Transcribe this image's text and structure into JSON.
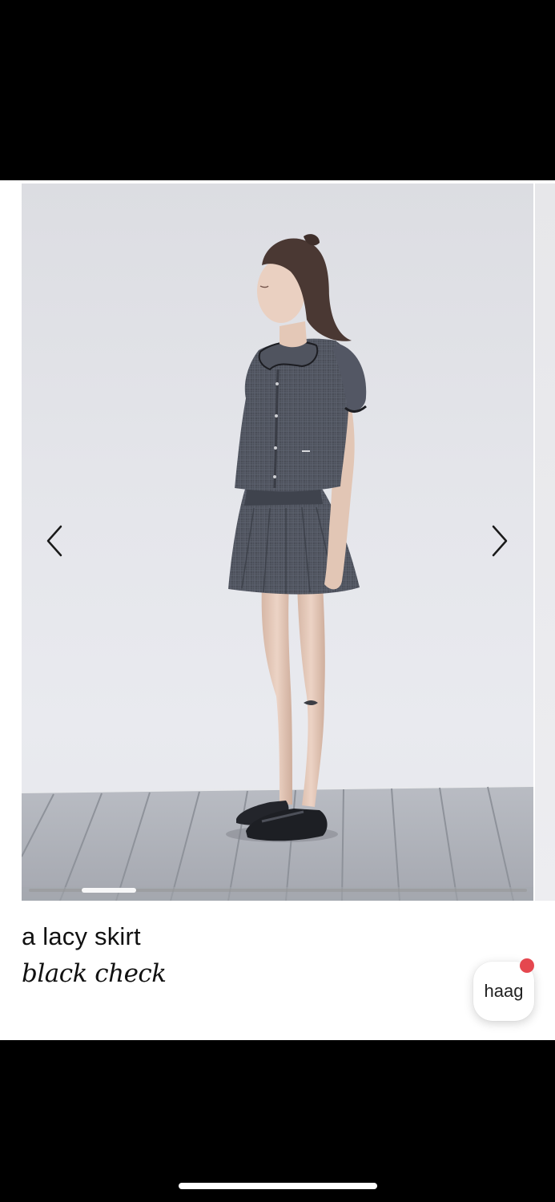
{
  "product": {
    "name": "a lacy skirt",
    "variant": "black check"
  },
  "gallery": {
    "image_description": "Model standing on grey deck in black check collared blouse and mini skirt, black shoes",
    "progress": 0.12,
    "prev_icon": "chevron-left-icon",
    "next_icon": "chevron-right-icon"
  },
  "chat_widget": {
    "label": "haag",
    "has_notification": true,
    "notification_color": "#e5474f"
  },
  "colors": {
    "background": "#ffffff",
    "text": "#111111",
    "letterbox": "#000000"
  }
}
